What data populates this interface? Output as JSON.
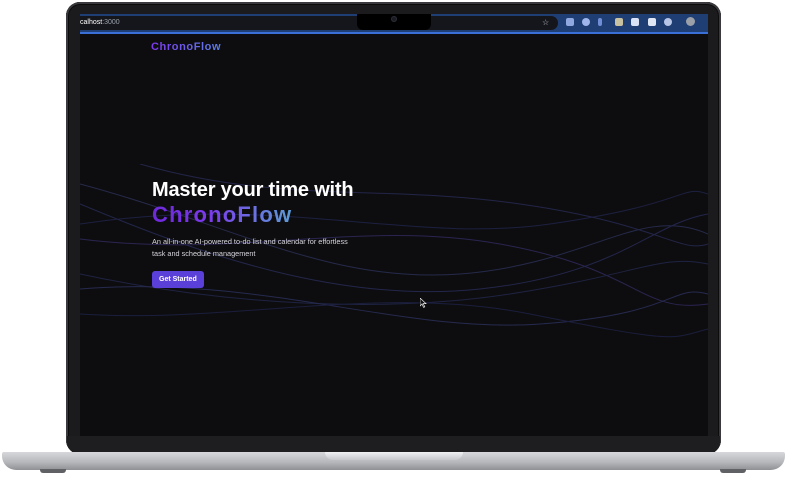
{
  "browser": {
    "url_host": "calhost",
    "url_port": ":3000",
    "bookmark_icon": "star-icon",
    "extensions": [
      {
        "name": "extension-icon",
        "color": "#8fa8e0"
      },
      {
        "name": "extension-icon",
        "color": "#9fb6ec"
      },
      {
        "name": "extension-icon",
        "color": "#6f8ed6"
      },
      {
        "name": "extension-icon",
        "color": "#c9c2a0"
      },
      {
        "name": "extension-icon",
        "color": "#d9e3f5"
      },
      {
        "name": "extension-icon",
        "color": "#e0e6f2"
      },
      {
        "name": "extension-icon",
        "color": "#b7c5e6"
      },
      {
        "name": "profile-avatar-icon",
        "color": "#9a9fa8"
      }
    ],
    "accent_color": "#3a6fd8"
  },
  "header": {
    "logo": "ChronoFlow"
  },
  "hero": {
    "title": "Master your time with",
    "brand": "ChronoFlow",
    "subtitle": "An all-in-one AI-powered to-do list and calendar for effortless task and schedule management",
    "cta_label": "Get Started"
  },
  "colors": {
    "background": "#0d0d10",
    "brand_purple": "#7c3aed",
    "cta_bg": "#5b3fd9"
  }
}
